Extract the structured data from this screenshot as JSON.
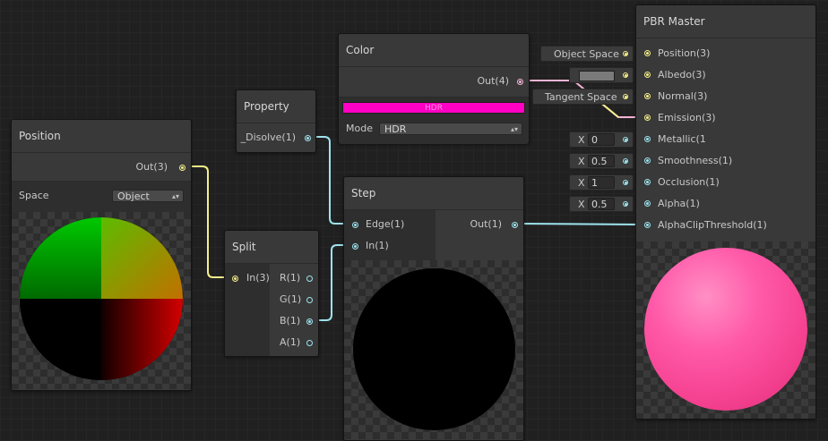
{
  "position_node": {
    "title": "Position",
    "out_label": "Out(3)",
    "space_label": "Space",
    "space_value": "Object"
  },
  "property_node": {
    "title": "Property",
    "out_label": "_Disolve(1)"
  },
  "color_node": {
    "title": "Color",
    "out_label": "Out(4)",
    "swatch_label": "HDR",
    "swatch_color": "#ff00c4",
    "mode_label": "Mode",
    "mode_value": "HDR"
  },
  "split_node": {
    "title": "Split",
    "in_label": "In(3)",
    "outputs": [
      "R(1)",
      "G(1)",
      "B(1)",
      "A(1)"
    ]
  },
  "step_node": {
    "title": "Step",
    "inputs": [
      "Edge(1)",
      "In(1)"
    ],
    "out_label": "Out(1)"
  },
  "master_node": {
    "title": "PBR Master",
    "inputs": [
      "Position(3)",
      "Albedo(3)",
      "Normal(3)",
      "Emission(3)",
      "Metallic(1",
      "Smoothness(1)",
      "Occlusion(1)",
      "Alpha(1)",
      "AlphaClipThreshold(1)"
    ],
    "preview_color": "#ff4aa0"
  },
  "inline_inputs": {
    "position_space": "Object Space",
    "normal_space": "Tangent Space",
    "albedo_color": "#7a7a7a",
    "metallic": {
      "axis": "X",
      "value": "0"
    },
    "smoothness": {
      "axis": "X",
      "value": "0.5"
    },
    "occlusion": {
      "axis": "X",
      "value": "1"
    },
    "alpha": {
      "axis": "X",
      "value": "0.5"
    }
  },
  "colors": {
    "wire_float": "#9ee4ee",
    "wire_vector3": "#f4ef8b",
    "wire_vector4": "#f5b4d7"
  }
}
